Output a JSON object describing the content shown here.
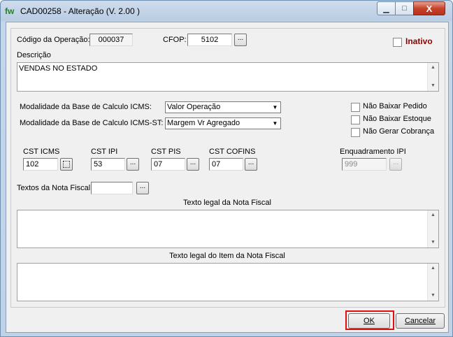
{
  "window": {
    "app_icon": "fw",
    "title": "CAD00258 - Alteração  (V.  2.00 )",
    "controls": {
      "minimize": "▁",
      "maximize": "□",
      "close": "X"
    }
  },
  "form": {
    "codigo_label": "Código da Operação:",
    "codigo_value": "000037",
    "cfop_label": "CFOP:",
    "cfop_value": "5102",
    "ellipsis": "...",
    "inativo_label": "Inativo",
    "inativo_checked": false,
    "descricao_label": "Descrição",
    "descricao_value": "VENDAS NO ESTADO",
    "modalidade_icms_label": "Modalidade da  Base de Calculo ICMS:",
    "modalidade_icms_value": "Valor Operação",
    "modalidade_icms_st_label": "Modalidade da  Base de Calculo ICMS-ST:",
    "modalidade_icms_st_value": "Margem Vr Agregado",
    "nao_baixar_pedido": "Não Baixar Pedido",
    "nao_baixar_estoque": "Não Baixar Estoque",
    "nao_gerar_cobranca": "Não Gerar Cobrança",
    "cst_icms_label": "CST ICMS",
    "cst_icms_value": "102",
    "cst_ipi_label": "CST  IPI",
    "cst_ipi_value": "53",
    "cst_pis_label": "CST PIS",
    "cst_pis_value": "07",
    "cst_cofins_label": "CST COFINS",
    "cst_cofins_value": "07",
    "enquadramento_label": "Enquadramento IPI",
    "enquadramento_value": "999",
    "textos_label": "Textos da Nota Fiscal",
    "textos_value": "",
    "texto_legal_label": "Texto legal da Nota Fiscal",
    "texto_legal_item_label": "Texto legal do Item da Nota Fiscal"
  },
  "buttons": {
    "ok": "OK",
    "cancelar": "Cancelar"
  }
}
